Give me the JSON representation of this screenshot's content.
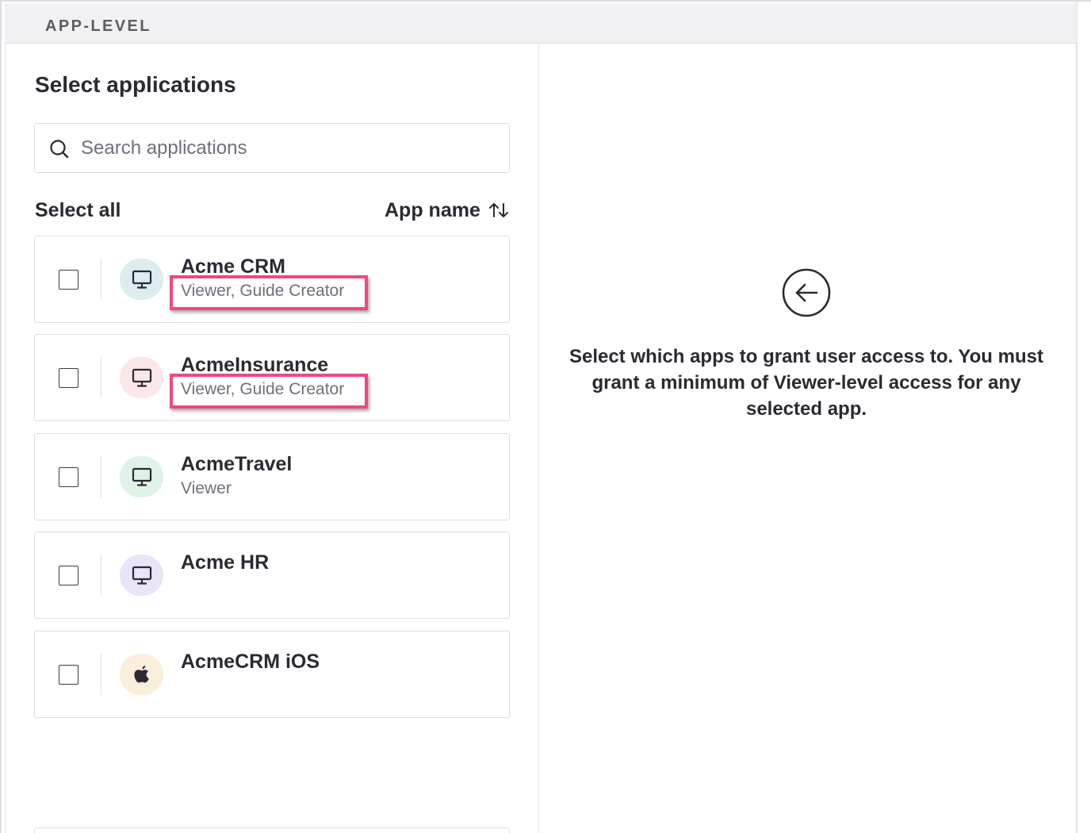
{
  "header": {
    "label": "APP-LEVEL"
  },
  "left_panel": {
    "title": "Select applications",
    "search": {
      "placeholder": "Search applications",
      "value": "",
      "icon": "search-icon"
    },
    "select_all_label": "Select all",
    "sort": {
      "label": "App name",
      "icon": "sort-arrows-icon"
    },
    "apps": [
      {
        "name": "Acme CRM",
        "role": "Viewer, Guide Creator",
        "icon": "monitor-icon",
        "icon_bg": "#dcecf0",
        "checked": false,
        "highlighted": true
      },
      {
        "name": "AcmeInsurance",
        "role": "Viewer, Guide Creator",
        "icon": "monitor-icon",
        "icon_bg": "#fbe6e8",
        "checked": false,
        "highlighted": true
      },
      {
        "name": "AcmeTravel",
        "role": "Viewer",
        "icon": "monitor-icon",
        "icon_bg": "#def2e8",
        "checked": false,
        "highlighted": false
      },
      {
        "name": "Acme HR",
        "role": "",
        "icon": "monitor-icon",
        "icon_bg": "#ebe3f7",
        "checked": false,
        "highlighted": false
      },
      {
        "name": "AcmeCRM iOS",
        "role": "",
        "icon": "apple-icon",
        "icon_bg": "#fbeedb",
        "checked": false,
        "highlighted": false
      }
    ]
  },
  "right_panel": {
    "icon": "arrow-left-circle-icon",
    "message": "Select which apps to grant user access to. You must grant a minimum of Viewer-level access for any selected app."
  },
  "colors": {
    "highlight": "#f0487f",
    "text": "#2a2a33",
    "muted": "#6e6f7a",
    "border": "#dcdde3"
  }
}
